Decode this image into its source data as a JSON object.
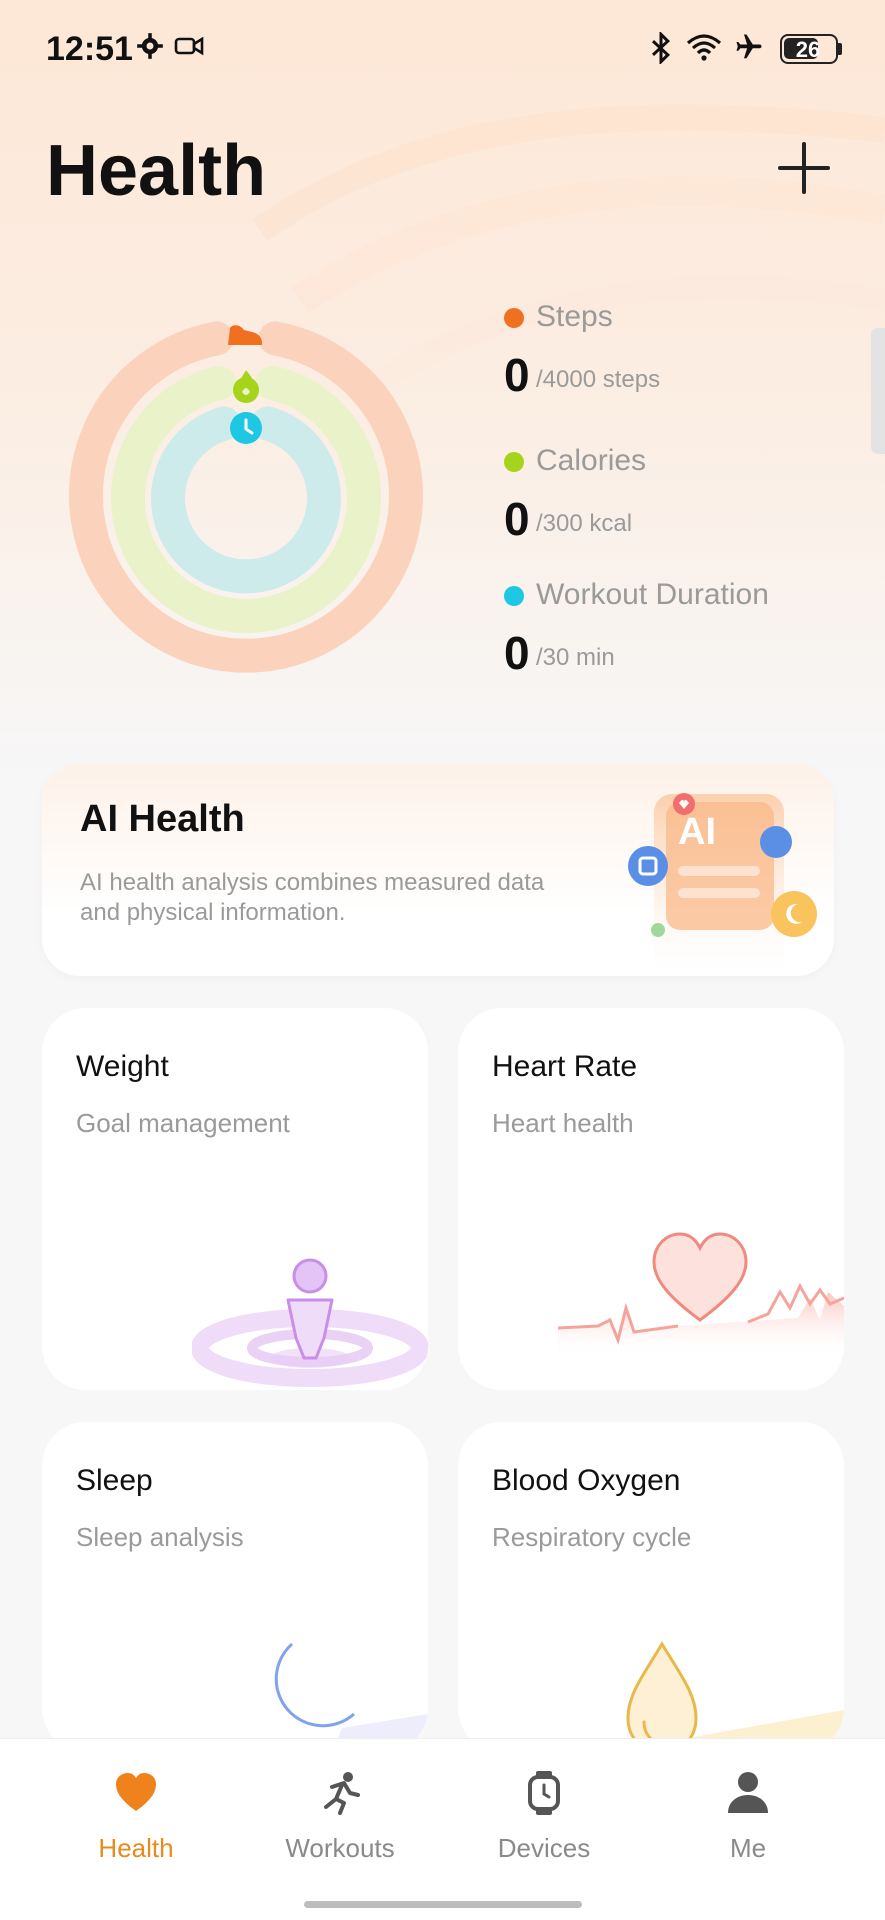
{
  "status_bar": {
    "time": "12:51",
    "battery": "26",
    "icons": [
      "settings-gear-icon",
      "video-camera-icon",
      "bluetooth-icon",
      "wifi-icon",
      "airplane-icon",
      "battery-icon"
    ]
  },
  "header": {
    "title": "Health",
    "add_icon": "plus-icon"
  },
  "rings": {
    "icons": [
      "shoe-icon",
      "flame-icon",
      "clock-icon"
    ],
    "progress": [
      0,
      0,
      0
    ]
  },
  "stats": [
    {
      "label": "Steps",
      "value": "0",
      "goal": "/4000 steps",
      "color": "#f07020"
    },
    {
      "label": "Calories",
      "value": "0",
      "goal": "/300 kcal",
      "color": "#a6d41c"
    },
    {
      "label": "Workout Duration",
      "value": "0",
      "goal": "/30 min",
      "color": "#1ec8e4"
    }
  ],
  "ai_card": {
    "title": "AI Health",
    "description": "AI health analysis combines measured data and physical information.",
    "badge": "AI"
  },
  "tiles": [
    {
      "title": "Weight",
      "subtitle": "Goal management",
      "icon": "person-scale-icon"
    },
    {
      "title": "Heart Rate",
      "subtitle": "Heart health",
      "icon": "heart-pulse-icon"
    },
    {
      "title": "Sleep",
      "subtitle": "Sleep analysis",
      "icon": "moon-icon"
    },
    {
      "title": "Blood Oxygen",
      "subtitle": "Respiratory cycle",
      "icon": "drop-icon"
    }
  ],
  "nav": {
    "items": [
      {
        "label": "Health",
        "icon": "heart-icon",
        "active": true
      },
      {
        "label": "Workouts",
        "icon": "running-icon",
        "active": false
      },
      {
        "label": "Devices",
        "icon": "watch-icon",
        "active": false
      },
      {
        "label": "Me",
        "icon": "person-icon",
        "active": false
      }
    ]
  },
  "colors": {
    "accent": "#e88a1c",
    "steps": "#f07020",
    "calories": "#a6d41c",
    "workout": "#1ec8e4"
  }
}
